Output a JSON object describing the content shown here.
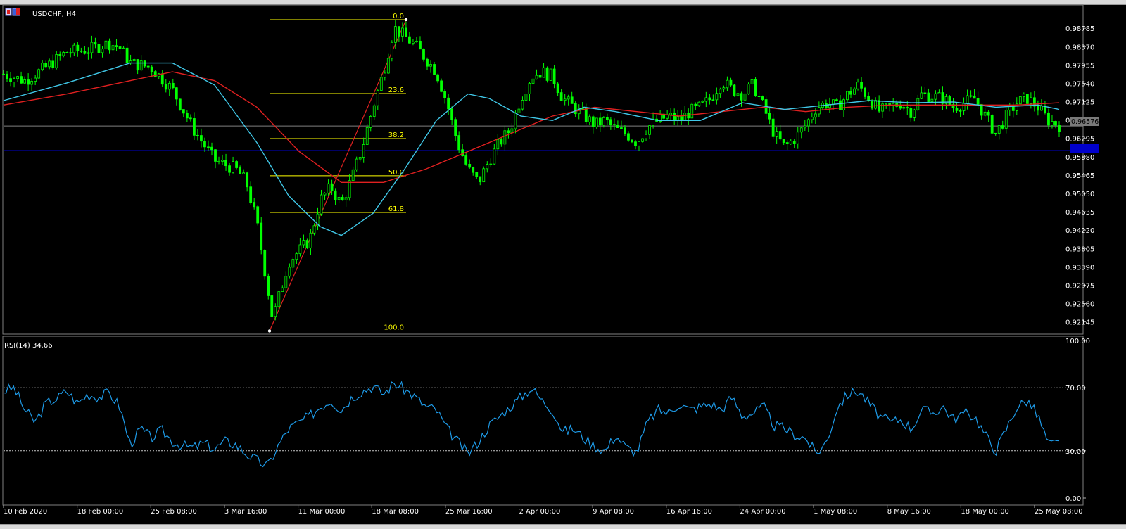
{
  "window": {
    "symbol_label": "USDCHF, H4"
  },
  "chart_data": [
    {
      "type": "candlestick",
      "title": "USDCHF, H4",
      "timeframe": "H4",
      "y_ticks": [
        "0.98785",
        "0.98370",
        "0.97955",
        "0.97540",
        "0.97125",
        "0.96710",
        "0.96295",
        "0.95880",
        "0.95465",
        "0.95050",
        "0.94635",
        "0.94220",
        "0.93805",
        "0.93390",
        "0.92975",
        "0.92560",
        "0.92145"
      ],
      "ylim": [
        0.919,
        0.9925
      ],
      "x_ticks": [
        "10 Feb 2020",
        "18 Feb 00:00",
        "25 Feb 08:00",
        "3 Mar 16:00",
        "11 Mar 00:00",
        "18 Mar 08:00",
        "25 Mar 16:00",
        "2 Apr 00:00",
        "9 Apr 08:00",
        "16 Apr 16:00",
        "24 Apr 00:00",
        "1 May 08:00",
        "8 May 16:00",
        "18 May 00:00",
        "25 May 08:00"
      ],
      "current_price": "0.96576",
      "horizontal_lines": [
        {
          "value": 0.96576,
          "color": "#808080"
        },
        {
          "value": 0.9602,
          "color": "#0000cc"
        }
      ],
      "fibonacci_levels": [
        {
          "label": "0.0",
          "value": 0.9898
        },
        {
          "label": "23.6",
          "value": 0.9731
        },
        {
          "label": "38.2",
          "value": 0.9629
        },
        {
          "label": "50.0",
          "value": 0.9545
        },
        {
          "label": "61.8",
          "value": 0.9462
        },
        {
          "label": "100.0",
          "value": 0.9194
        }
      ],
      "colors": {
        "candles": "#00ff00",
        "ma_fast": "#40c8e8",
        "ma_slow": "#e02020",
        "fib": "#ffff00",
        "rsi": "#1e9be8"
      },
      "price_path": [
        [
          0,
          0.9775
        ],
        [
          0.02,
          0.976
        ],
        [
          0.04,
          0.979
        ],
        [
          0.06,
          0.9825
        ],
        [
          0.08,
          0.983
        ],
        [
          0.1,
          0.9845
        ],
        [
          0.11,
          0.9835
        ],
        [
          0.12,
          0.98
        ],
        [
          0.14,
          0.979
        ],
        [
          0.16,
          0.974
        ],
        [
          0.18,
          0.965
        ],
        [
          0.2,
          0.958
        ],
        [
          0.22,
          0.956
        ],
        [
          0.23,
          0.953
        ],
        [
          0.24,
          0.944
        ],
        [
          0.255,
          0.922
        ],
        [
          0.27,
          0.935
        ],
        [
          0.29,
          0.94
        ],
        [
          0.3,
          0.949
        ],
        [
          0.31,
          0.952
        ],
        [
          0.32,
          0.948
        ],
        [
          0.33,
          0.954
        ],
        [
          0.34,
          0.961
        ],
        [
          0.35,
          0.97
        ],
        [
          0.36,
          0.978
        ],
        [
          0.37,
          0.988
        ],
        [
          0.38,
          0.986
        ],
        [
          0.39,
          0.984
        ],
        [
          0.4,
          0.981
        ],
        [
          0.41,
          0.978
        ],
        [
          0.42,
          0.971
        ],
        [
          0.43,
          0.962
        ],
        [
          0.44,
          0.956
        ],
        [
          0.45,
          0.953
        ],
        [
          0.46,
          0.958
        ],
        [
          0.47,
          0.962
        ],
        [
          0.48,
          0.965
        ],
        [
          0.49,
          0.972
        ],
        [
          0.5,
          0.977
        ],
        [
          0.51,
          0.978
        ],
        [
          0.52,
          0.977
        ],
        [
          0.53,
          0.972
        ],
        [
          0.54,
          0.97
        ],
        [
          0.55,
          0.968
        ],
        [
          0.56,
          0.966
        ],
        [
          0.57,
          0.967
        ],
        [
          0.58,
          0.965
        ],
        [
          0.59,
          0.964
        ],
        [
          0.6,
          0.962
        ],
        [
          0.61,
          0.9655
        ],
        [
          0.62,
          0.967
        ],
        [
          0.63,
          0.968
        ],
        [
          0.64,
          0.967
        ],
        [
          0.65,
          0.969
        ],
        [
          0.66,
          0.97
        ],
        [
          0.67,
          0.972
        ],
        [
          0.68,
          0.976
        ],
        [
          0.69,
          0.974
        ],
        [
          0.7,
          0.973
        ],
        [
          0.71,
          0.975
        ],
        [
          0.72,
          0.97
        ],
        [
          0.73,
          0.964
        ],
        [
          0.74,
          0.961
        ],
        [
          0.75,
          0.963
        ],
        [
          0.76,
          0.966
        ],
        [
          0.77,
          0.97
        ],
        [
          0.78,
          0.971
        ],
        [
          0.79,
          0.97
        ],
        [
          0.8,
          0.973
        ],
        [
          0.81,
          0.975
        ],
        [
          0.82,
          0.972
        ],
        [
          0.83,
          0.969
        ],
        [
          0.84,
          0.97
        ],
        [
          0.85,
          0.971
        ],
        [
          0.86,
          0.969
        ],
        [
          0.87,
          0.973
        ],
        [
          0.88,
          0.9725
        ],
        [
          0.89,
          0.972
        ],
        [
          0.9,
          0.97
        ],
        [
          0.91,
          0.971
        ],
        [
          0.92,
          0.972
        ],
        [
          0.93,
          0.968
        ],
        [
          0.94,
          0.964
        ],
        [
          0.95,
          0.968
        ],
        [
          0.96,
          0.971
        ],
        [
          0.97,
          0.972
        ],
        [
          0.98,
          0.97
        ],
        [
          0.99,
          0.967
        ],
        [
          1.0,
          0.966
        ]
      ],
      "ma_fast_path": [
        [
          0,
          0.9715
        ],
        [
          0.06,
          0.9755
        ],
        [
          0.12,
          0.98
        ],
        [
          0.16,
          0.98
        ],
        [
          0.2,
          0.975
        ],
        [
          0.24,
          0.962
        ],
        [
          0.27,
          0.95
        ],
        [
          0.3,
          0.943
        ],
        [
          0.32,
          0.941
        ],
        [
          0.35,
          0.946
        ],
        [
          0.38,
          0.956
        ],
        [
          0.41,
          0.967
        ],
        [
          0.44,
          0.973
        ],
        [
          0.46,
          0.972
        ],
        [
          0.49,
          0.968
        ],
        [
          0.52,
          0.967
        ],
        [
          0.55,
          0.97
        ],
        [
          0.58,
          0.969
        ],
        [
          0.62,
          0.967
        ],
        [
          0.66,
          0.967
        ],
        [
          0.7,
          0.971
        ],
        [
          0.74,
          0.9695
        ],
        [
          0.78,
          0.9705
        ],
        [
          0.82,
          0.9715
        ],
        [
          0.86,
          0.971
        ],
        [
          0.9,
          0.9712
        ],
        [
          0.94,
          0.97
        ],
        [
          0.98,
          0.9705
        ],
        [
          1.0,
          0.9695
        ]
      ],
      "ma_slow_path": [
        [
          0,
          0.9705
        ],
        [
          0.06,
          0.973
        ],
        [
          0.12,
          0.976
        ],
        [
          0.16,
          0.978
        ],
        [
          0.2,
          0.976
        ],
        [
          0.24,
          0.97
        ],
        [
          0.28,
          0.96
        ],
        [
          0.32,
          0.953
        ],
        [
          0.36,
          0.953
        ],
        [
          0.4,
          0.956
        ],
        [
          0.44,
          0.96
        ],
        [
          0.48,
          0.964
        ],
        [
          0.52,
          0.968
        ],
        [
          0.56,
          0.97
        ],
        [
          0.6,
          0.969
        ],
        [
          0.64,
          0.968
        ],
        [
          0.68,
          0.969
        ],
        [
          0.72,
          0.97
        ],
        [
          0.76,
          0.969
        ],
        [
          0.8,
          0.97
        ],
        [
          0.84,
          0.9705
        ],
        [
          0.88,
          0.9705
        ],
        [
          0.92,
          0.9705
        ],
        [
          0.96,
          0.9705
        ],
        [
          1.0,
          0.971
        ]
      ]
    },
    {
      "type": "line",
      "title": "RSI(14) 34.66",
      "indicator": "RSI(14)",
      "value": "34.66",
      "y_ticks": [
        "100.00",
        "70.00",
        "30.00",
        "0.00"
      ],
      "ylim": [
        0,
        100
      ],
      "levels": [
        70,
        30
      ],
      "rsi_path": [
        [
          0,
          68
        ],
        [
          0.01,
          70
        ],
        [
          0.02,
          56
        ],
        [
          0.03,
          48
        ],
        [
          0.04,
          60
        ],
        [
          0.05,
          63
        ],
        [
          0.06,
          68
        ],
        [
          0.07,
          60
        ],
        [
          0.08,
          66
        ],
        [
          0.09,
          64
        ],
        [
          0.1,
          67
        ],
        [
          0.11,
          58
        ],
        [
          0.12,
          34
        ],
        [
          0.13,
          44
        ],
        [
          0.14,
          38
        ],
        [
          0.15,
          43
        ],
        [
          0.16,
          36
        ],
        [
          0.17,
          33
        ],
        [
          0.18,
          32
        ],
        [
          0.19,
          35
        ],
        [
          0.2,
          31
        ],
        [
          0.21,
          36
        ],
        [
          0.22,
          34
        ],
        [
          0.23,
          28
        ],
        [
          0.24,
          24
        ],
        [
          0.25,
          20
        ],
        [
          0.26,
          33
        ],
        [
          0.27,
          44
        ],
        [
          0.28,
          48
        ],
        [
          0.29,
          52
        ],
        [
          0.3,
          58
        ],
        [
          0.31,
          62
        ],
        [
          0.32,
          56
        ],
        [
          0.33,
          64
        ],
        [
          0.34,
          68
        ],
        [
          0.35,
          71
        ],
        [
          0.36,
          66
        ],
        [
          0.37,
          73
        ],
        [
          0.38,
          69
        ],
        [
          0.39,
          64
        ],
        [
          0.4,
          58
        ],
        [
          0.41,
          56
        ],
        [
          0.42,
          44
        ],
        [
          0.43,
          36
        ],
        [
          0.44,
          28
        ],
        [
          0.45,
          36
        ],
        [
          0.46,
          46
        ],
        [
          0.47,
          52
        ],
        [
          0.48,
          58
        ],
        [
          0.49,
          64
        ],
        [
          0.5,
          70
        ],
        [
          0.51,
          62
        ],
        [
          0.52,
          56
        ],
        [
          0.53,
          42
        ],
        [
          0.54,
          44
        ],
        [
          0.55,
          38
        ],
        [
          0.56,
          33
        ],
        [
          0.57,
          30
        ],
        [
          0.58,
          40
        ],
        [
          0.59,
          32
        ],
        [
          0.6,
          29
        ],
        [
          0.61,
          48
        ],
        [
          0.62,
          56
        ],
        [
          0.63,
          54
        ],
        [
          0.64,
          60
        ],
        [
          0.65,
          56
        ],
        [
          0.66,
          58
        ],
        [
          0.67,
          60
        ],
        [
          0.68,
          56
        ],
        [
          0.69,
          64
        ],
        [
          0.7,
          52
        ],
        [
          0.71,
          54
        ],
        [
          0.72,
          58
        ],
        [
          0.73,
          46
        ],
        [
          0.74,
          44
        ],
        [
          0.75,
          40
        ],
        [
          0.76,
          38
        ],
        [
          0.77,
          28
        ],
        [
          0.78,
          36
        ],
        [
          0.79,
          58
        ],
        [
          0.8,
          66
        ],
        [
          0.81,
          68
        ],
        [
          0.82,
          60
        ],
        [
          0.83,
          52
        ],
        [
          0.84,
          48
        ],
        [
          0.85,
          50
        ],
        [
          0.86,
          44
        ],
        [
          0.87,
          56
        ],
        [
          0.88,
          54
        ],
        [
          0.89,
          58
        ],
        [
          0.9,
          50
        ],
        [
          0.91,
          54
        ],
        [
          0.92,
          52
        ],
        [
          0.93,
          40
        ],
        [
          0.94,
          30
        ],
        [
          0.95,
          44
        ],
        [
          0.96,
          58
        ],
        [
          0.97,
          62
        ],
        [
          0.98,
          52
        ],
        [
          0.99,
          34
        ],
        [
          1.0,
          35
        ]
      ]
    }
  ]
}
